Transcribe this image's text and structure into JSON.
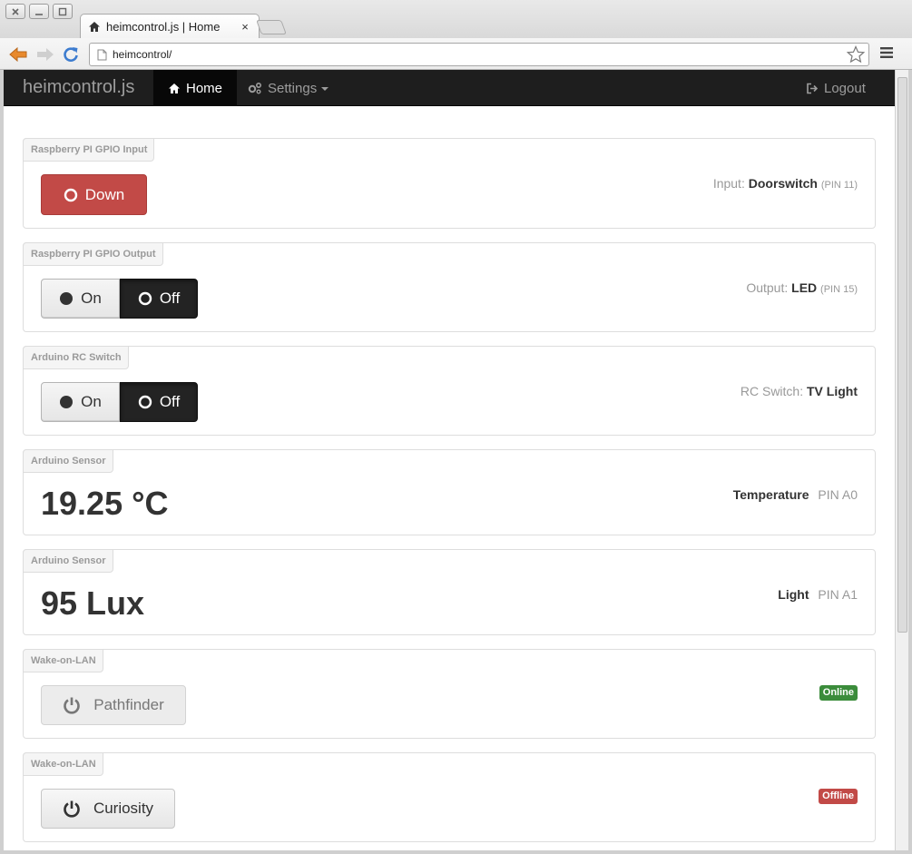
{
  "browser": {
    "tab_title": "heimcontrol.js | Home",
    "tab_close": "×",
    "url": "heimcontrol/"
  },
  "navbar": {
    "brand": "heimcontrol.js",
    "home": "Home",
    "settings": "Settings",
    "logout": "Logout"
  },
  "panels": {
    "gpio_input": {
      "label": "Raspberry PI GPIO Input",
      "button": "Down",
      "info_prefix": "Input:",
      "info_name": "Doorswitch",
      "info_pin": "(PIN 11)"
    },
    "gpio_output": {
      "label": "Raspberry PI GPIO Output",
      "on": "On",
      "off": "Off",
      "info_prefix": "Output:",
      "info_name": "LED",
      "info_pin": "(PIN 15)"
    },
    "rc_switch": {
      "label": "Arduino RC Switch",
      "on": "On",
      "off": "Off",
      "info_prefix": "RC Switch:",
      "info_name": "TV Light"
    },
    "sensor_temp": {
      "label": "Arduino Sensor",
      "value": "19.25 °C",
      "name": "Temperature",
      "pin": "PIN A0"
    },
    "sensor_light": {
      "label": "Arduino Sensor",
      "value": "95 Lux",
      "name": "Light",
      "pin": "PIN A1"
    },
    "wol_1": {
      "label": "Wake-on-LAN",
      "button": "Pathfinder",
      "status": "Online"
    },
    "wol_2": {
      "label": "Wake-on-LAN",
      "button": "Curiosity",
      "status": "Offline"
    }
  },
  "colors": {
    "danger": "#c24a47",
    "success": "#3b8c3b",
    "navbar": "#1e1e1e"
  }
}
